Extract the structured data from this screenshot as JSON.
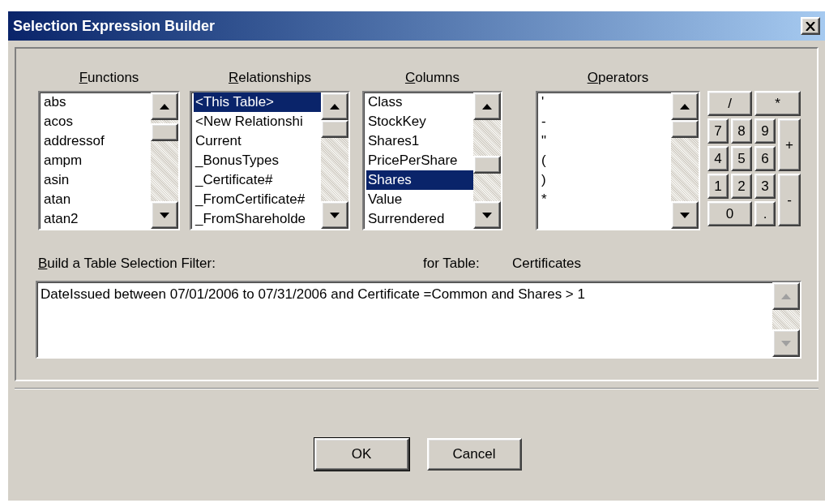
{
  "window": {
    "title": "Selection Expression Builder"
  },
  "lists": [
    {
      "heading": "Functions",
      "items": [
        {
          "label": "abs",
          "selected": false
        },
        {
          "label": "acos",
          "selected": false
        },
        {
          "label": "addressof",
          "selected": false
        },
        {
          "label": "ampm",
          "selected": false
        },
        {
          "label": "asin",
          "selected": false
        },
        {
          "label": "atan",
          "selected": false
        },
        {
          "label": "atan2",
          "selected": false
        }
      ]
    },
    {
      "heading": "Relationships",
      "items": [
        {
          "label": "<This Table>",
          "selected": true
        },
        {
          "label": "<New Relationshi",
          "selected": false
        },
        {
          "label": "Current",
          "selected": false
        },
        {
          "label": "_BonusTypes",
          "selected": false
        },
        {
          "label": "_Certificate#",
          "selected": false
        },
        {
          "label": "_FromCertificate#",
          "selected": false
        },
        {
          "label": "_FromShareholde",
          "selected": false
        }
      ]
    },
    {
      "heading": "Columns",
      "items": [
        {
          "label": "Class",
          "selected": false
        },
        {
          "label": "StockKey",
          "selected": false
        },
        {
          "label": "Shares1",
          "selected": false
        },
        {
          "label": "PricePerShare",
          "selected": false
        },
        {
          "label": "Shares",
          "selected": true
        },
        {
          "label": "Value",
          "selected": false
        },
        {
          "label": "Surrendered",
          "selected": false
        }
      ]
    },
    {
      "heading": "Operators",
      "items": [
        {
          "label": "'",
          "selected": false
        },
        {
          "label": "-",
          "selected": false
        },
        {
          "label": "\"",
          "selected": false
        },
        {
          "label": "(",
          "selected": false
        },
        {
          "label": ")",
          "selected": false
        },
        {
          "label": "*",
          "selected": false
        }
      ]
    }
  ],
  "keypad": [
    {
      "label": "/",
      "kind": "wide"
    },
    {
      "label": "*",
      "kind": "wide"
    },
    {
      "label": "7",
      "kind": "key"
    },
    {
      "label": "8",
      "kind": "key"
    },
    {
      "label": "9",
      "kind": "key"
    },
    {
      "label": "+",
      "kind": "tall"
    },
    {
      "label": "4",
      "kind": "key"
    },
    {
      "label": "5",
      "kind": "key"
    },
    {
      "label": "6",
      "kind": "key"
    },
    {
      "label": "1",
      "kind": "key"
    },
    {
      "label": "2",
      "kind": "key"
    },
    {
      "label": "3",
      "kind": "key"
    },
    {
      "label": "-",
      "kind": "tall"
    },
    {
      "label": "0",
      "kind": "wide"
    },
    {
      "label": ".",
      "kind": "key"
    }
  ],
  "filter": {
    "label": "Build a Table Selection Filter:",
    "table_label": "for Table:",
    "table_name": "Certificates",
    "value": "DateIssued between 07/01/2006 to 07/31/2006 and Certificate =Common and Shares > 1"
  },
  "buttons": [
    {
      "label": "OK",
      "default": true
    },
    {
      "label": "Cancel",
      "default": false
    }
  ]
}
